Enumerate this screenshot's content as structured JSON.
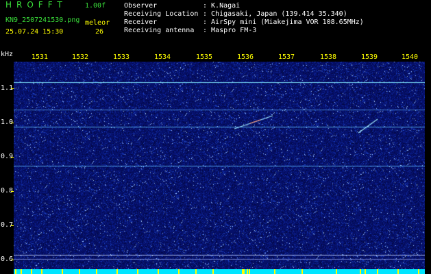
{
  "header": {
    "app_title": "HROFFT",
    "version": "1.00f",
    "filename": "KN9_2507241530.png",
    "mode_label": "meleor",
    "datetime": "25.07.24 15:30",
    "count": "26"
  },
  "station_info": [
    {
      "label": "Observer",
      "value": ": K.Nagai"
    },
    {
      "label": "Receiving Location",
      "value": ": Chigasaki, Japan (139.414 35.340)"
    },
    {
      "label": "Receiver",
      "value": ": AirSpy mini (Miakejima VOR 108.65MHz)"
    },
    {
      "label": "Receiving antenna",
      "value": ": Maspro FM-3"
    }
  ],
  "axis": {
    "y_unit": "kHz",
    "y_ticks": [
      "1.1",
      "1.0",
      "0.9",
      "0.8",
      "0.7",
      "0.6"
    ],
    "x_ticks": [
      "1531",
      "1532",
      "1533",
      "1534",
      "1535",
      "1536",
      "1537",
      "1538",
      "1539",
      "1540"
    ]
  },
  "colors": {
    "background": "#000000",
    "waterfall_base": "#06106a",
    "title_green": "#3adf3a",
    "label_yellow": "#ffff00",
    "bottom_bar": "#00e5ff"
  }
}
